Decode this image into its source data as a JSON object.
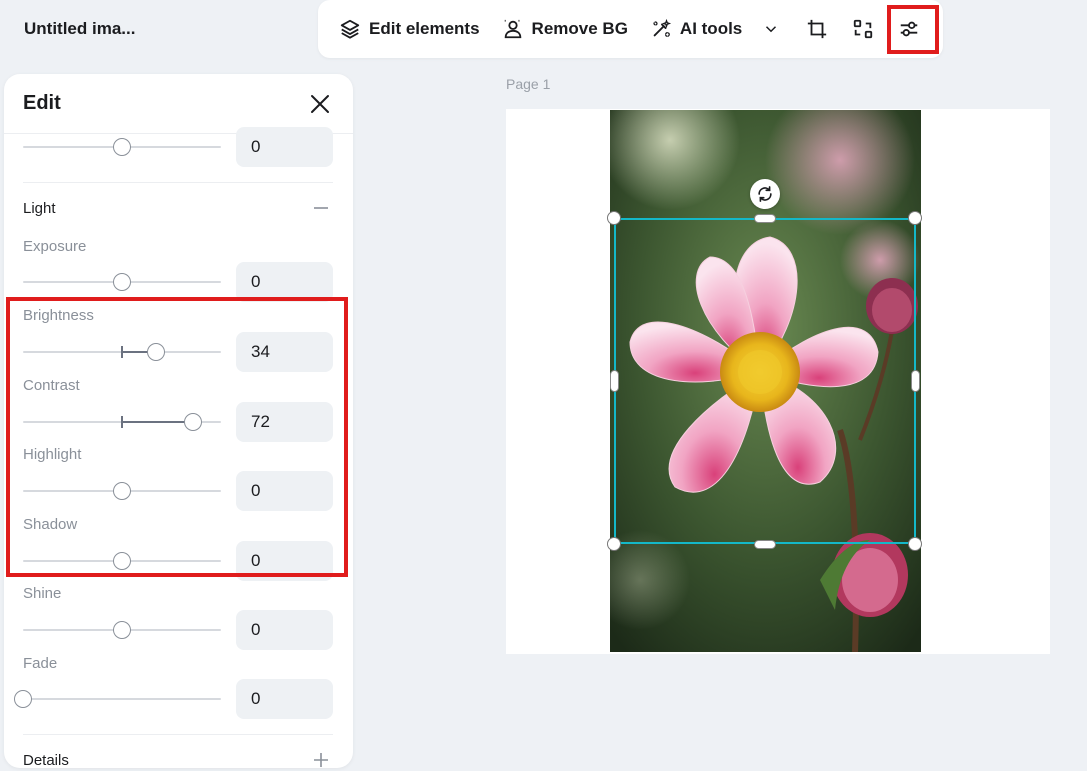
{
  "document": {
    "title": "Untitled ima..."
  },
  "toolbar": {
    "edit_elements": "Edit elements",
    "remove_bg": "Remove BG",
    "ai_tools": "AI tools",
    "icons": [
      "layers-icon",
      "person-outline-icon",
      "magic-wand-icon",
      "chevron-down-icon",
      "crop-icon",
      "transform-icon",
      "adjust-sliders-icon"
    ]
  },
  "panel": {
    "title": "Edit",
    "top_slider": {
      "value": "0",
      "level": 0.5
    },
    "light_section": {
      "title": "Light",
      "expanded": true
    },
    "sliders": {
      "exposure": {
        "label": "Exposure",
        "value": "0",
        "level": 0.5
      },
      "brightness": {
        "label": "Brightness",
        "value": "34",
        "level": 0.67
      },
      "contrast": {
        "label": "Contrast",
        "value": "72",
        "level": 0.86
      },
      "highlight": {
        "label": "Highlight",
        "value": "0",
        "level": 0.5
      },
      "shadow": {
        "label": "Shadow",
        "value": "0",
        "level": 0.5
      },
      "shine": {
        "label": "Shine",
        "value": "0",
        "level": 0.5
      },
      "fade": {
        "label": "Fade",
        "value": "0",
        "level": 0.0
      }
    },
    "details_section": {
      "title": "Details",
      "expanded": false
    }
  },
  "canvas": {
    "page_label": "Page 1"
  },
  "colors": {
    "highlight": "#e01c1c",
    "selection": "#14b8c8",
    "panel_bg": "#ffffff",
    "app_bg": "#eef1f5"
  }
}
